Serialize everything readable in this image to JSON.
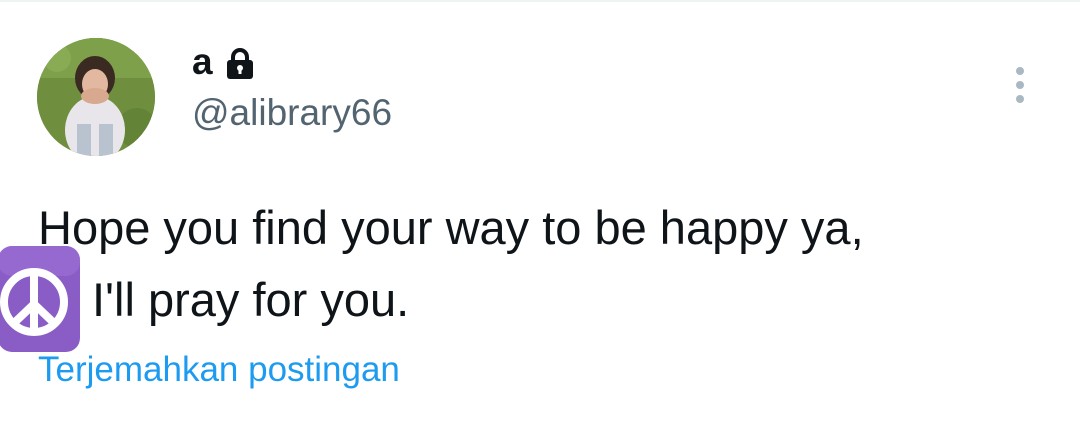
{
  "post": {
    "author": {
      "display_name": "a",
      "handle": "@alibrary66",
      "avatar_icon": "profile-photo",
      "protected_icon": "lock-icon"
    },
    "text_line_1": "Hope you find your way to be happy ya,",
    "text_line_2": "I'll pray for you.",
    "emoji": "peace-symbol-emoji",
    "translate_label": "Terjemahkan postingan",
    "more_icon": "more-vertical-icon"
  },
  "colors": {
    "text_primary": "#0f1419",
    "text_secondary": "#536471",
    "link": "#1d9bf0",
    "emoji_purple": "#8a5cc6"
  }
}
